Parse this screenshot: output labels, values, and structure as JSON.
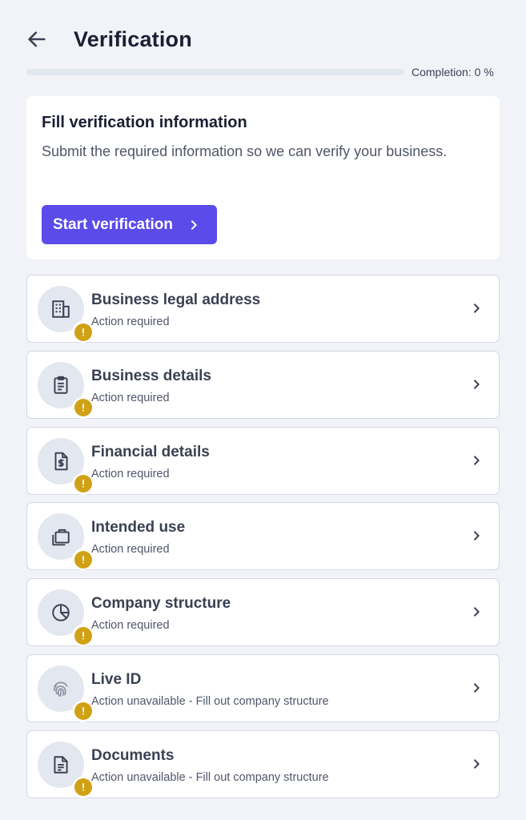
{
  "header": {
    "title": "Verification"
  },
  "progress": {
    "label": "Completion: 0 %",
    "value_percent": 0
  },
  "intro": {
    "title": "Fill verification information",
    "description": "Submit the required information so we can verify your business.",
    "button_label": "Start verification"
  },
  "steps": [
    {
      "title": "Business legal address",
      "status": "Action required",
      "icon": "building-icon"
    },
    {
      "title": "Business details",
      "status": "Action required",
      "icon": "clipboard-icon"
    },
    {
      "title": "Financial details",
      "status": "Action required",
      "icon": "dollar-document-icon"
    },
    {
      "title": "Intended use",
      "status": "Action required",
      "icon": "briefcase-icon"
    },
    {
      "title": "Company structure",
      "status": "Action required",
      "icon": "pie-chart-icon"
    },
    {
      "title": "Live ID",
      "status": "Action unavailable - Fill out company structure",
      "icon": "fingerprint-icon"
    },
    {
      "title": "Documents",
      "status": "Action unavailable - Fill out company structure",
      "icon": "document-icon"
    }
  ],
  "colors": {
    "accent": "#5a4bea",
    "warning": "#d1a115",
    "background": "#f1f3f8"
  }
}
